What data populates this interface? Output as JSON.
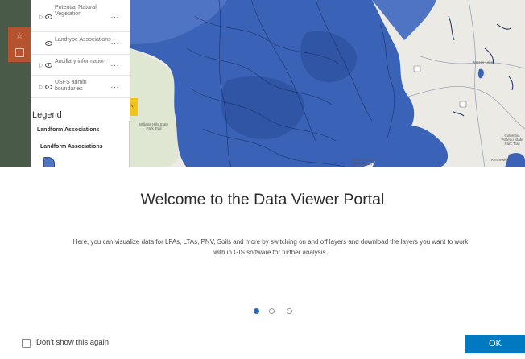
{
  "layers": [
    {
      "name": "Potential Natural Vegetation"
    },
    {
      "name": "Landtype Associations"
    },
    {
      "name": "Ancillary information"
    },
    {
      "name": "USFS admin boundaries"
    }
  ],
  "layer_more_label": "···",
  "legend": {
    "title": "Legend",
    "group_label": "Landform Associations",
    "item_label": "Landform Associations",
    "swatch_color": "#4f74c4"
  },
  "map": {
    "labels": {
      "moses_lake": "Moses Lake",
      "columbia": "Columbia Plateau State Park Trail",
      "willapa": "Willapa Hills State Park Trail",
      "kennewick": "Kennewick",
      "yakama": "Yakama Nation Reservation"
    },
    "colors": {
      "water": "#3a63b8",
      "land": "#eceae4"
    }
  },
  "modal": {
    "title": "Welcome to the Data Viewer Portal",
    "body": "Here, you can visualize data for LFAs, LTAs, PNV, Soils and more by switching on and off layers and download the layers you want to work with in GIS software for further analysis.",
    "dont_show_label": "Don't show this again",
    "ok_label": "OK",
    "accent_color": "#0079c1"
  },
  "carousel": {
    "current_page": 1,
    "total_pages": 3
  }
}
